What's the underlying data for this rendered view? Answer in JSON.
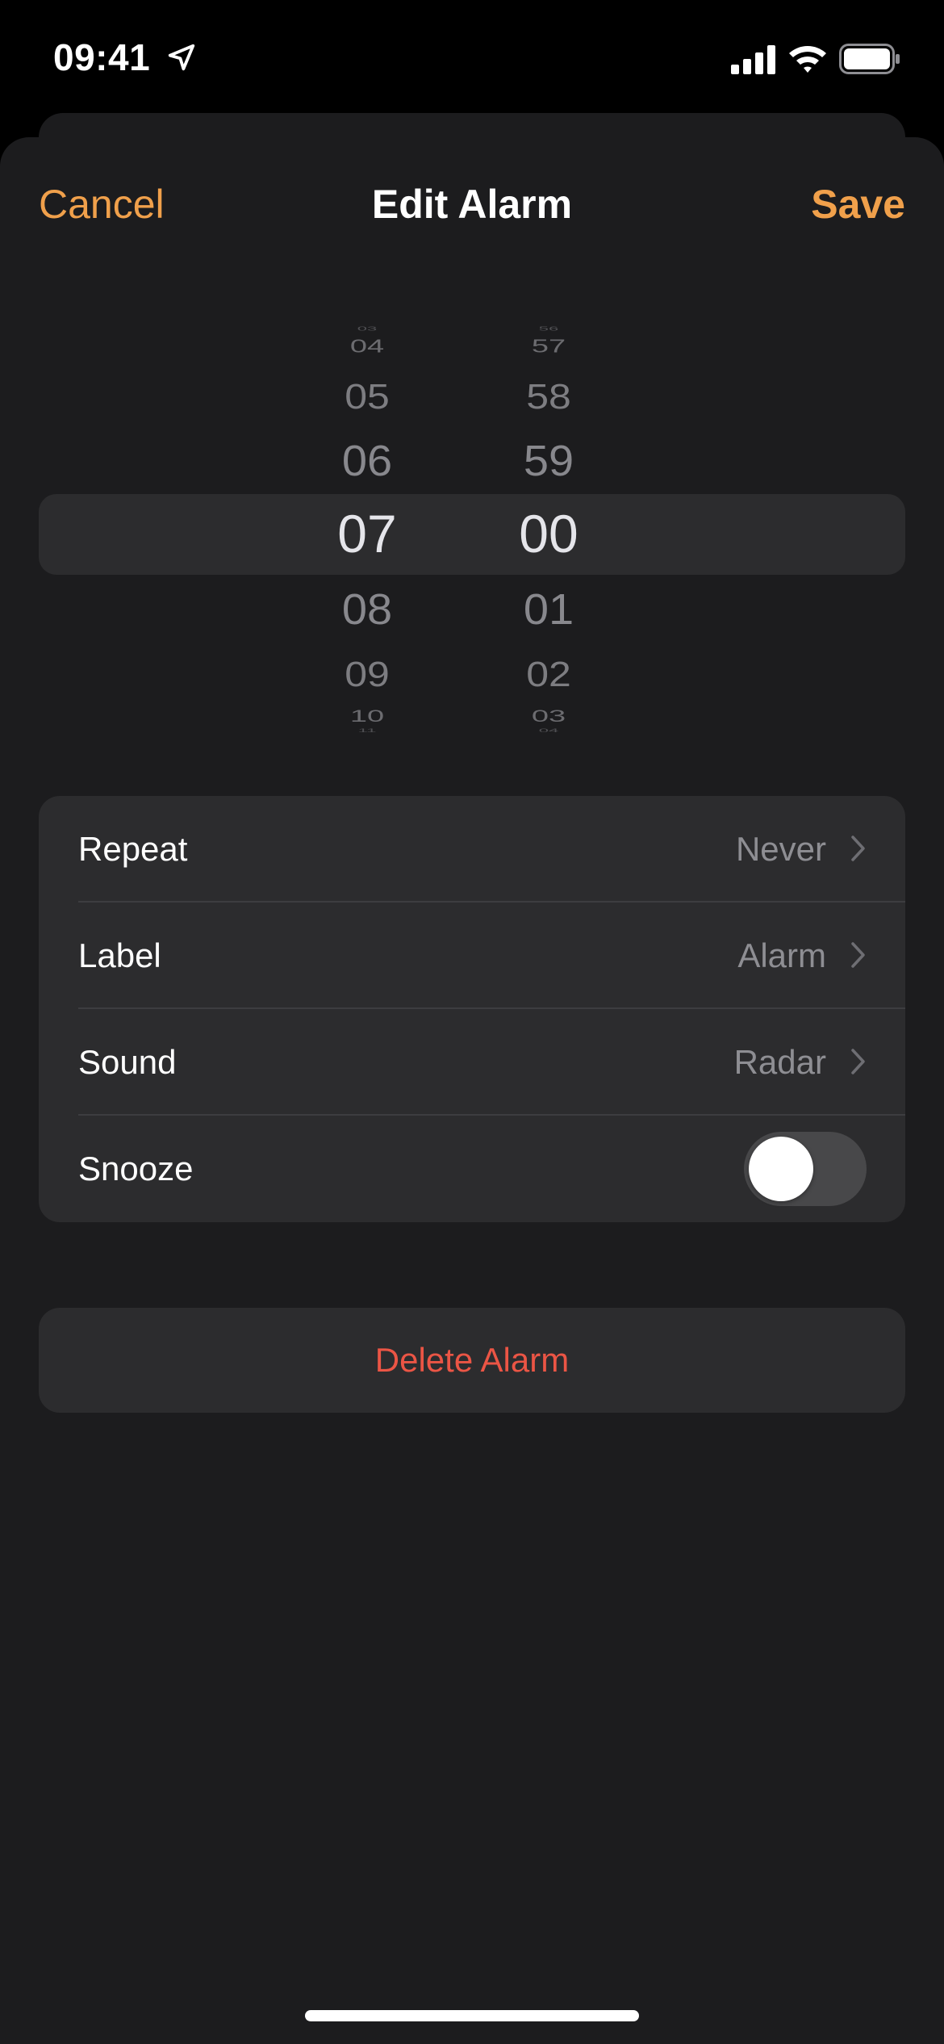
{
  "status_bar": {
    "time": "09:41",
    "location_icon": "location-arrow-icon",
    "signal_icon": "cellular-signal-icon",
    "wifi_icon": "wifi-icon",
    "battery_icon": "battery-icon"
  },
  "nav": {
    "cancel_label": "Cancel",
    "title": "Edit Alarm",
    "save_label": "Save"
  },
  "picker": {
    "hours": [
      "03",
      "04",
      "05",
      "06",
      "07",
      "08",
      "09",
      "10",
      "11"
    ],
    "minutes": [
      "56",
      "57",
      "58",
      "59",
      "00",
      "01",
      "02",
      "03",
      "04"
    ],
    "selected_hour": "07",
    "selected_minute": "00"
  },
  "settings": {
    "repeat": {
      "label": "Repeat",
      "value": "Never"
    },
    "alarm_label": {
      "label": "Label",
      "value": "Alarm"
    },
    "sound": {
      "label": "Sound",
      "value": "Radar"
    },
    "snooze": {
      "label": "Snooze",
      "enabled": false
    }
  },
  "delete": {
    "label": "Delete Alarm"
  },
  "colors": {
    "accent": "#f0a04b",
    "destructive": "#eb5545",
    "sheet_bg": "#1c1c1e",
    "cell_bg": "#2c2c2e",
    "secondary_text": "#8e8e93"
  }
}
